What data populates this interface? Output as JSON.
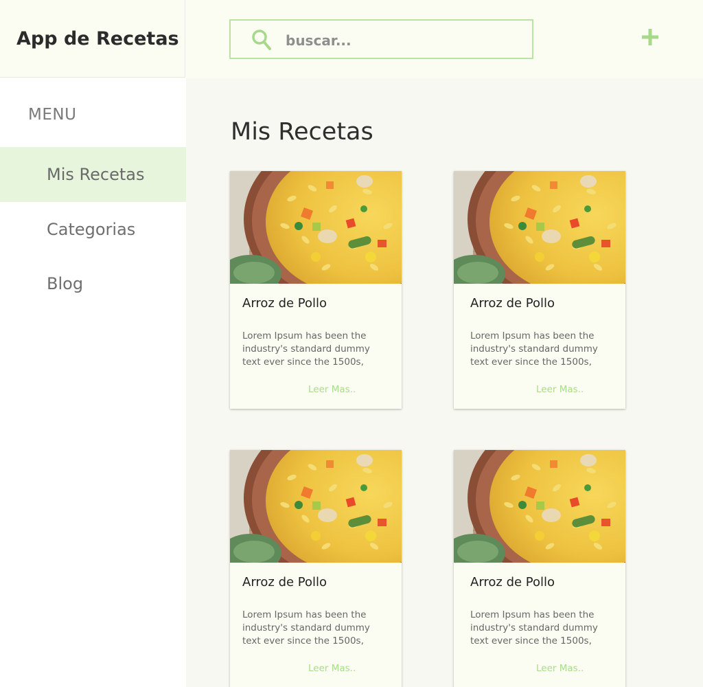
{
  "app": {
    "title": "App de Recetas"
  },
  "search": {
    "placeholder": "buscar..."
  },
  "sidebar": {
    "menu_label": "MENU",
    "items": [
      {
        "label": "Mis Recetas",
        "active": true
      },
      {
        "label": "Categorias",
        "active": false
      },
      {
        "label": "Blog",
        "active": false
      }
    ]
  },
  "main": {
    "title": "Mis Recetas",
    "cards": [
      {
        "title": "Arroz de Pollo",
        "text": "Lorem Ipsum has been the industry's standard dummy text ever since the 1500s,",
        "link": "Leer Mas.."
      },
      {
        "title": "Arroz de Pollo",
        "text": "Lorem Ipsum has been the industry's standard dummy text ever since the 1500s,",
        "link": "Leer Mas.."
      },
      {
        "title": "Arroz de Pollo",
        "text": "Lorem Ipsum has been the industry's standard dummy text ever since the 1500s,",
        "link": "Leer Mas.."
      },
      {
        "title": "Arroz de Pollo",
        "text": "Lorem Ipsum has been the industry's standard dummy text ever since the 1500s,",
        "link": "Leer Mas.."
      }
    ]
  },
  "icons": {
    "search": "search-icon",
    "add": "plus-icon"
  },
  "colors": {
    "accent": "#a6d98a",
    "active_nav": "#e6f5dc",
    "header_bg": "#fcfdf2"
  }
}
